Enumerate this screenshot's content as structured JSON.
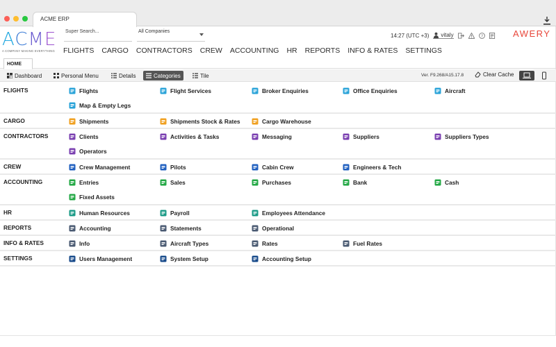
{
  "window": {
    "tab_title": "ACME ERP"
  },
  "logo": {
    "letters": [
      "A",
      "C",
      "M",
      "E"
    ],
    "tagline": "A COMPANY MAKING EVERYTHING"
  },
  "search": {
    "placeholder": "Super Search..."
  },
  "company_select": {
    "value": "All Companies"
  },
  "status": {
    "time": "14:27 (UTC +3)",
    "user": "vitaly"
  },
  "brand_right": "AWERY",
  "main_nav": [
    "FLIGHTS",
    "CARGO",
    "CONTRACTORS",
    "CREW",
    "ACCOUNTING",
    "HR",
    "REPORTS",
    "INFO & RATES",
    "SETTINGS"
  ],
  "home_tab": "HOME",
  "toolbar": {
    "dashboard": "Dashboard",
    "personal_menu": "Personal Menu",
    "details": "Details",
    "categories": "Categories",
    "tile": "Tile",
    "version": "Ver. F9.268/A15.17.8",
    "clear_cache": "Clear Cache"
  },
  "categories": [
    {
      "name": "FLIGHTS",
      "items": [
        {
          "label": "Flights",
          "icon": "flights-icon",
          "color": "#2aa3d8"
        },
        {
          "label": "Flight Services",
          "icon": "flight-services-icon",
          "color": "#2aa3d8"
        },
        {
          "label": "Broker Enquiries",
          "icon": "broker-enquiries-icon",
          "color": "#2aa3d8"
        },
        {
          "label": "Office Enquiries",
          "icon": "office-enquiries-icon",
          "color": "#2aa3d8"
        },
        {
          "label": "Aircraft",
          "icon": "aircraft-icon",
          "color": "#2aa3d8"
        },
        {
          "label": "Map & Empty Legs",
          "icon": "map-marker-icon",
          "color": "#2aa3d8"
        }
      ]
    },
    {
      "name": "CARGO",
      "items": [
        {
          "label": "Shipments",
          "icon": "box-icon",
          "color": "#f0a020"
        },
        {
          "label": "Shipments Stock & Rates",
          "icon": "boxes-icon",
          "color": "#f0a020"
        },
        {
          "label": "Cargo Warehouse",
          "icon": "warehouse-icon",
          "color": "#f0a020"
        }
      ]
    },
    {
      "name": "CONTRACTORS",
      "items": [
        {
          "label": "Clients",
          "icon": "clients-icon",
          "color": "#7a3fb0"
        },
        {
          "label": "Activities & Tasks",
          "icon": "tasks-icon",
          "color": "#7a3fb0"
        },
        {
          "label": "Messaging",
          "icon": "envelope-icon",
          "color": "#7a3fb0"
        },
        {
          "label": "Suppliers",
          "icon": "suppliers-icon",
          "color": "#7a3fb0"
        },
        {
          "label": "Suppliers Types",
          "icon": "list-icon",
          "color": "#7a3fb0"
        },
        {
          "label": "Operators",
          "icon": "operators-icon",
          "color": "#7a3fb0"
        }
      ]
    },
    {
      "name": "CREW",
      "items": [
        {
          "label": "Crew Management",
          "icon": "crew-icon",
          "color": "#1f5fbf"
        },
        {
          "label": "Pilots",
          "icon": "pilot-icon",
          "color": "#1f5fbf"
        },
        {
          "label": "Cabin Crew",
          "icon": "cabin-crew-icon",
          "color": "#1f5fbf"
        },
        {
          "label": "Engineers & Tech",
          "icon": "engineer-icon",
          "color": "#1f5fbf"
        }
      ]
    },
    {
      "name": "ACCOUNTING",
      "items": [
        {
          "label": "Entries",
          "icon": "wallet-icon",
          "color": "#23a845"
        },
        {
          "label": "Sales",
          "icon": "sales-icon",
          "color": "#23a845"
        },
        {
          "label": "Purchases",
          "icon": "cart-icon",
          "color": "#23a845"
        },
        {
          "label": "Bank",
          "icon": "bank-icon",
          "color": "#23a845"
        },
        {
          "label": "Cash",
          "icon": "cash-icon",
          "color": "#23a845"
        },
        {
          "label": "Fixed Assets",
          "icon": "diamond-icon",
          "color": "#23a845"
        }
      ]
    },
    {
      "name": "HR",
      "items": [
        {
          "label": "Human Resources",
          "icon": "people-icon",
          "color": "#1a9a86"
        },
        {
          "label": "Payroll",
          "icon": "payroll-icon",
          "color": "#1a9a86"
        },
        {
          "label": "Employees Attendance",
          "icon": "attendance-icon",
          "color": "#1a9a86"
        }
      ]
    },
    {
      "name": "REPORTS",
      "items": [
        {
          "label": "Accounting",
          "icon": "report-icon",
          "color": "#4a5a72"
        },
        {
          "label": "Statements",
          "icon": "statements-icon",
          "color": "#4a5a72"
        },
        {
          "label": "Operational",
          "icon": "document-icon",
          "color": "#4a5a72"
        }
      ]
    },
    {
      "name": "INFO & RATES",
      "items": [
        {
          "label": "Info",
          "icon": "globe-icon",
          "color": "#4a5a72"
        },
        {
          "label": "Aircraft Types",
          "icon": "plane-icon",
          "color": "#4a5a72"
        },
        {
          "label": "Rates",
          "icon": "chart-icon",
          "color": "#4a5a72"
        },
        {
          "label": "Fuel Rates",
          "icon": "drop-icon",
          "color": "#4a5a72"
        }
      ]
    },
    {
      "name": "SETTINGS",
      "items": [
        {
          "label": "Users Management",
          "icon": "user-circle-icon",
          "color": "#174a8a"
        },
        {
          "label": "System Setup",
          "icon": "gear-icon",
          "color": "#174a8a"
        },
        {
          "label": "Accounting Setup",
          "icon": "settings-box-icon",
          "color": "#174a8a"
        }
      ]
    }
  ]
}
